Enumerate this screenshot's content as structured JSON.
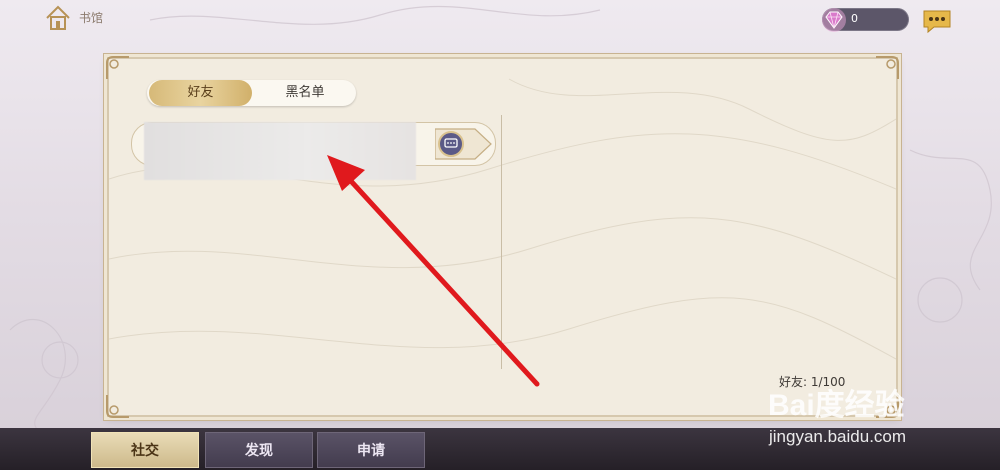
{
  "topbar": {
    "home_label": "书馆",
    "gem_count": "0"
  },
  "tabs": {
    "friends": "好友",
    "blacklist": "黑名单"
  },
  "friends_panel": {
    "count_text": "好友: 1/100"
  },
  "bottom_nav": {
    "social": "社交",
    "discover": "发现",
    "apply": "申请"
  },
  "watermark": {
    "logo": "Bai度经验",
    "url": "jingyan.baidu.com"
  },
  "colors": {
    "accent_gold": "#d6b978",
    "annotation_arrow": "#e0191d",
    "panel_bg": "#f2ece0"
  }
}
